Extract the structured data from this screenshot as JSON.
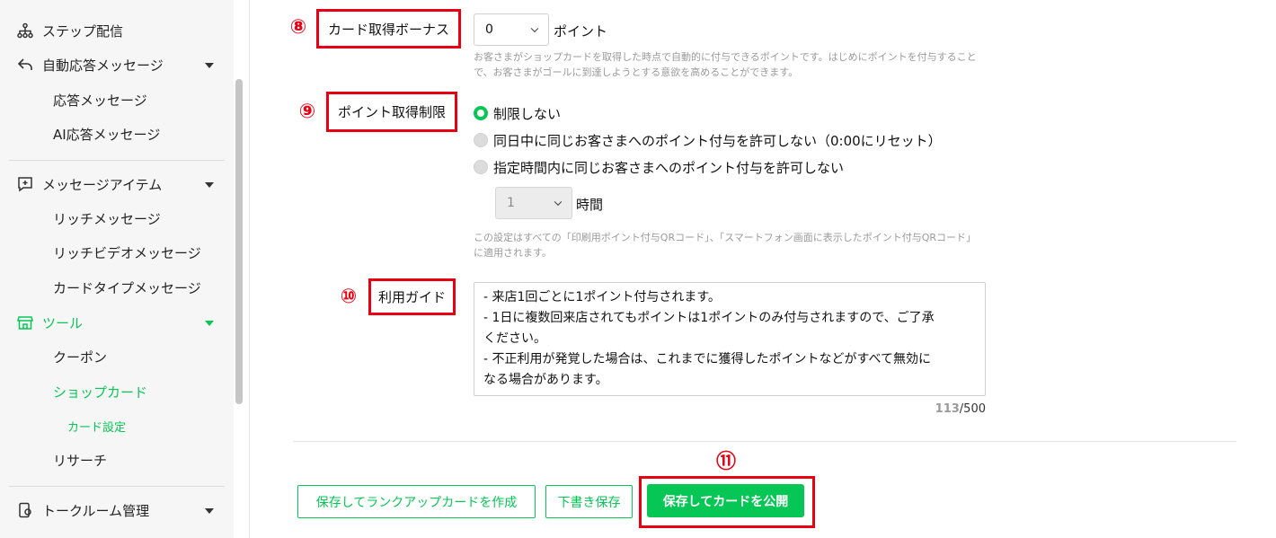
{
  "sidebar": {
    "items": [
      {
        "label": "ステップ配信",
        "icon": "hierarchy-icon"
      },
      {
        "label": "自動応答メッセージ",
        "icon": "reply-arrow-icon"
      },
      {
        "label": "応答メッセージ"
      },
      {
        "label": "AI応答メッセージ"
      },
      {
        "label": "メッセージアイテム",
        "icon": "chat-plus-icon"
      },
      {
        "label": "リッチメッセージ"
      },
      {
        "label": "リッチビデオメッセージ"
      },
      {
        "label": "カードタイプメッセージ"
      },
      {
        "label": "ツール",
        "icon": "shop-icon"
      },
      {
        "label": "クーポン"
      },
      {
        "label": "ショップカード"
      },
      {
        "label": "カード設定"
      },
      {
        "label": "リサーチ"
      },
      {
        "label": "トークルーム管理",
        "icon": "phone-gear-icon"
      }
    ]
  },
  "annotations": {
    "n8": "⑧",
    "n9": "⑨",
    "n10": "⑩",
    "n11": "⑪"
  },
  "bonus": {
    "label": "カード取得ボーナス",
    "value": "0",
    "unit": "ポイント",
    "help": "お客さまがショップカードを取得した時点で自動的に付与できるポイントです。はじめにポイントを付与することで、お客さまがゴールに到達しようとする意欲を高めることができます。"
  },
  "limit": {
    "label": "ポイント取得制限",
    "options": [
      "制限しない",
      "同日中に同じお客さまへのポイント付与を許可しない（0:00にリセット）",
      "指定時間内に同じお客さまへのポイント付与を許可しない"
    ],
    "hours_value": "1",
    "hours_unit": "時間",
    "help": "この設定はすべての「印刷用ポイント付与QRコード」、「スマートフォン画面に表示したポイント付与QRコード」に適用されます。"
  },
  "guide": {
    "label": "利用ガイド",
    "lines": [
      "- 来店1回ごとに1ポイント付与されます。",
      "- 1日に複数回来店されてもポイントは1ポイントのみ付与されますので、ご了承",
      "ください。",
      "- 不正利用が発覚した場合は、これまでに獲得したポイントなどがすべて無効に",
      "なる場合があります。"
    ],
    "count": "113",
    "max": "/500"
  },
  "buttons": {
    "rankup": "保存してランクアップカードを作成",
    "draft": "下書き保存",
    "publish": "保存してカードを公開"
  },
  "colors": {
    "accent": "#06c755",
    "annotation": "#e60012"
  }
}
